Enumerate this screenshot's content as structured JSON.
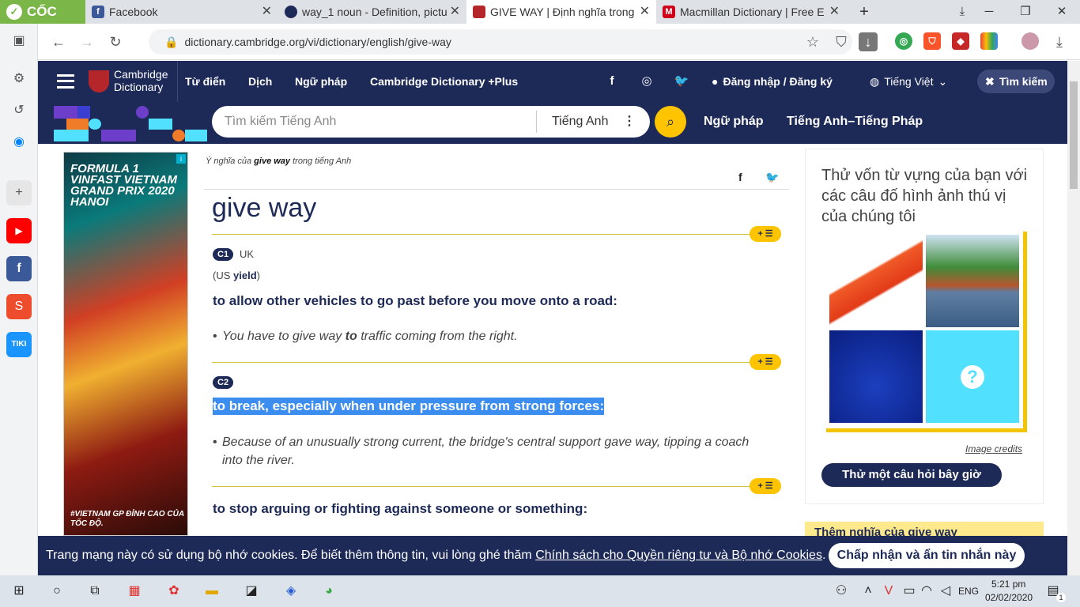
{
  "browser": {
    "brand": "CỐC CỐC",
    "tabs": [
      {
        "title": "Facebook",
        "icon": "facebook-icon"
      },
      {
        "title": "way_1 noun - Definition, pictu",
        "icon": "oxford-icon"
      },
      {
        "title": "GIVE WAY | Định nghĩa trong",
        "icon": "cambridge-icon"
      },
      {
        "title": "Macmillan Dictionary | Free E",
        "icon": "macmillan-icon"
      }
    ],
    "url": "dictionary.cambridge.org/vi/dictionary/english/give-way"
  },
  "site": {
    "logo_line1": "Cambridge",
    "logo_line2": "Dictionary",
    "nav": [
      "Từ điển",
      "Dịch",
      "Ngữ pháp",
      "Cambridge Dictionary +Plus"
    ],
    "login": "Đăng nhập / Đăng ký",
    "language": "Tiếng Việt",
    "search_button": "Tìm kiếm",
    "search_placeholder": "Tìm kiếm Tiếng Anh",
    "search_lang": "Tiếng Anh",
    "links": [
      "Ngữ pháp",
      "Tiếng Anh–Tiếng Pháp"
    ]
  },
  "ad": {
    "title": "FORMULA 1 VINFAST VIETNAM GRAND PRIX 2020 HANOI",
    "slogan": "#VIETNAM GP ĐỈNH CAO CỦA TỐC ĐỘ."
  },
  "entry": {
    "meaning_prefix": "Ý nghĩa của",
    "meaning_word": "give way",
    "meaning_suffix": "trong tiếng Anh",
    "headword": "give way",
    "plus_label": "+ ☰",
    "senses": [
      {
        "level": "C1",
        "region": "UK",
        "variant_pre": "(US",
        "variant_word": "yield",
        "variant_post": ")",
        "definition": "to allow other vehicles to go past before you move onto a road:",
        "example_pre": "You have to give way",
        "example_bold": "to",
        "example_post": "traffic coming from the right."
      },
      {
        "level": "C2",
        "definition": "to break, especially when under pressure from strong forces:",
        "example": "Because of an unusually strong current, the bridge's central support gave way, tipping a coach into the river."
      },
      {
        "definition": "to stop arguing or fighting against someone or something:"
      }
    ]
  },
  "quiz": {
    "text": "Thử vốn từ vựng của bạn với các câu đố hình ảnh thú vị của chúng tôi",
    "credits": "Image credits",
    "button": "Thử một câu hỏi bây giờ",
    "question_mark": "?"
  },
  "more": "Thêm nghĩa của give way",
  "cookie": {
    "text": "Trang mạng này có sử dụng bộ nhớ cookies. Để biết thêm thông tin, vui lòng ghé thăm",
    "link": "Chính sách cho Quyền riêng tư và Bộ nhớ Cookies",
    "button": "Chấp nhận và ẩn tin nhắn này"
  },
  "taskbar": {
    "lang": "ENG",
    "time": "5:21 pm",
    "date": "02/02/2020",
    "notif": "1"
  }
}
